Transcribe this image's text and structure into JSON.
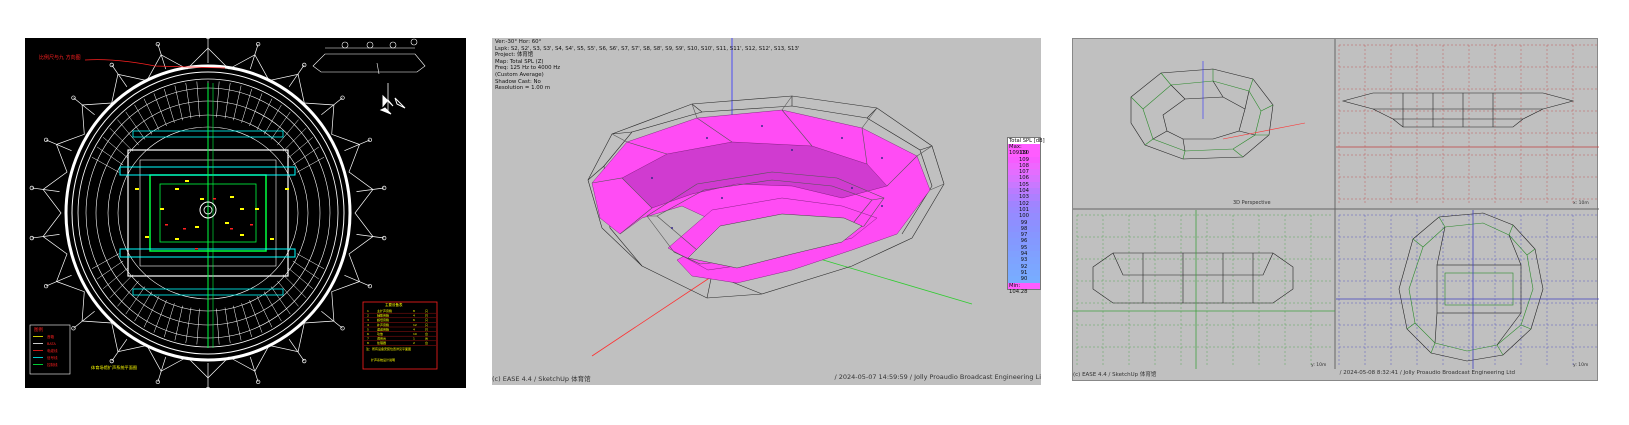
{
  "cad": {
    "title_red": "比例尺与九 方向图",
    "legend_box_title": "图例",
    "legend_items": [
      "音箱",
      "BATA",
      "电缆线",
      "信号线",
      "控制线"
    ],
    "table_title": "主要设备表",
    "table_rows": [
      [
        "1",
        "主扩声音箱",
        "8",
        "只"
      ],
      [
        "2",
        "辅助音箱",
        "4",
        "只"
      ],
      [
        "3",
        "超低音箱",
        "6",
        "只"
      ],
      [
        "4",
        "补声音箱",
        "12",
        "只"
      ],
      [
        "5",
        "返送音箱",
        "4",
        "只"
      ],
      [
        "6",
        "功放",
        "10",
        "台"
      ],
      [
        "7",
        "调音台",
        "1",
        "台"
      ],
      [
        "8",
        "处理器",
        "2",
        "台"
      ]
    ],
    "table_note": "注：所有设备安装位置详见平面图",
    "table_note2": "扩声系统设计说明",
    "drawing_title": "体育场馆扩声系统平面图",
    "colors": {
      "bg": "#000000",
      "lines": "#ffffff",
      "cyan": "#00ffff",
      "yellow": "#ffff00",
      "red": "#ff2020",
      "green": "#00ff40"
    }
  },
  "ease": {
    "info_lines": [
      "Ver:-30°  Hor: 60°",
      "Lspk: S2, S2', S3, S3', S4, S4', S5, S5', S6, S6', S7, S7', S8, S8', S9, S9', S10, S10', S11, S11', S12, S12', S13, S13'",
      "Project: 体育馆",
      "Map: Total SPL (Z)",
      "Freq: 125 Hz to 4000 Hz",
      "(Custom Average)",
      "Shadow Cast: No",
      "Resolution =   1.00 m"
    ],
    "legend": {
      "header": "Total SPL [dB]",
      "max_label": "Max: 109.09",
      "min_label": "Min: 104.28",
      "levels": [
        {
          "label": "110",
          "color": "#ff5cff"
        },
        {
          "label": "109",
          "color": "#f75cff"
        },
        {
          "label": "108",
          "color": "#ef66ff"
        },
        {
          "label": "107",
          "color": "#e46dff"
        },
        {
          "label": "106",
          "color": "#d872ff"
        },
        {
          "label": "105",
          "color": "#c978ff"
        },
        {
          "label": "104",
          "color": "#ba7bff"
        },
        {
          "label": "103",
          "color": "#ad80ff"
        },
        {
          "label": "102",
          "color": "#a084ff"
        },
        {
          "label": "101",
          "color": "#9a88ff"
        },
        {
          "label": "100",
          "color": "#948cff"
        },
        {
          "label": "99",
          "color": "#8e8fff"
        },
        {
          "label": "98",
          "color": "#8a92ff"
        },
        {
          "label": "97",
          "color": "#8796ff"
        },
        {
          "label": "96",
          "color": "#8499ff"
        },
        {
          "label": "95",
          "color": "#829cff"
        },
        {
          "label": "94",
          "color": "#80a0ff"
        },
        {
          "label": "93",
          "color": "#7ea3ff"
        },
        {
          "label": "92",
          "color": "#7ca6ff"
        },
        {
          "label": "91",
          "color": "#7aa9ff"
        },
        {
          "label": "90",
          "color": "#78acff"
        }
      ]
    },
    "footer_left": "(c) EASE 4.4  / SketchUp 体育馆",
    "footer_right": "/ 2024-05-07 14:59:59 / Jolly Proaudio Broadcast Engineering Li",
    "colors": {
      "surface": "#ff4cf4",
      "surface_dark": "#d03bd0",
      "axis_x": "#ff3030",
      "axis_y": "#2ecc2e",
      "axis_z": "#3030ff",
      "bg": "#c0c0c0"
    }
  },
  "quad": {
    "view_perspective": "3D Perspective",
    "view_scale_top": "x: 10m",
    "view_scale_bl": "y: 10m",
    "view_scale_br": "y: 10m",
    "footer_left": "(c) EASE 4.4  / SketchUp 体育馆",
    "footer_right": "/ 2024-05-08 8:32:41 / Jolly Proaudio Broadcast Engineering Ltd",
    "colors": {
      "bg": "#c0c0c0",
      "grid_red": "#c04040",
      "grid_green": "#40a040",
      "grid_blue": "#4040c0",
      "wire": "#222222",
      "wire_green": "#2a8a2a"
    }
  }
}
